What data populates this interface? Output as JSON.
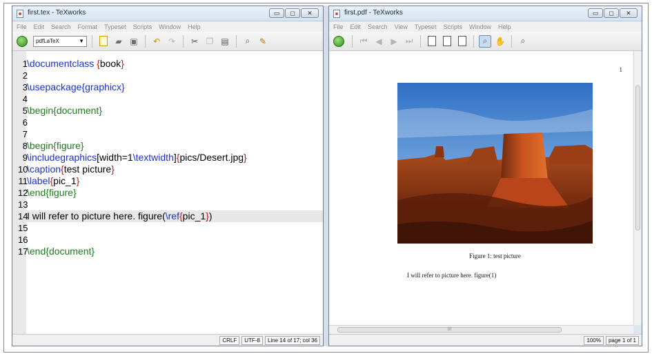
{
  "editor_window": {
    "title": "first.tex - TeXworks",
    "menu": [
      "File",
      "Edit",
      "Search",
      "Format",
      "Typeset",
      "Scripts",
      "Window",
      "Help"
    ],
    "engine": "pdfLaTeX",
    "lines": [
      {
        "n": "1",
        "tokens": [
          {
            "t": "\\documentclass",
            "c": "cmd"
          },
          {
            "t": " {",
            "c": "brace-c"
          },
          {
            "t": "book",
            "c": "plain"
          },
          {
            "t": "}",
            "c": "brace-c"
          }
        ]
      },
      {
        "n": "2",
        "tokens": []
      },
      {
        "n": "3",
        "tokens": [
          {
            "t": "\\usepackage",
            "c": "cmd"
          },
          {
            "t": "{",
            "c": "cmd"
          },
          {
            "t": "graphicx",
            "c": "cmd"
          },
          {
            "t": "}",
            "c": "cmd"
          }
        ]
      },
      {
        "n": "4",
        "tokens": []
      },
      {
        "n": "5",
        "tokens": [
          {
            "t": "\\begin",
            "c": "env"
          },
          {
            "t": "{",
            "c": "env"
          },
          {
            "t": "document",
            "c": "env"
          },
          {
            "t": "}",
            "c": "env"
          }
        ]
      },
      {
        "n": "6",
        "tokens": []
      },
      {
        "n": "7",
        "tokens": []
      },
      {
        "n": "8",
        "tokens": [
          {
            "t": "\\begin",
            "c": "env"
          },
          {
            "t": "{",
            "c": "env"
          },
          {
            "t": "figure",
            "c": "env"
          },
          {
            "t": "}",
            "c": "env"
          }
        ]
      },
      {
        "n": "9",
        "tokens": [
          {
            "t": "\\includegraphics",
            "c": "cmd"
          },
          {
            "t": "[width=1",
            "c": "plain"
          },
          {
            "t": "\\textwidth",
            "c": "cmd"
          },
          {
            "t": "]",
            "c": "plain"
          },
          {
            "t": "{",
            "c": "brace-c"
          },
          {
            "t": "pics/Desert.jpg",
            "c": "plain"
          },
          {
            "t": "}",
            "c": "brace-c"
          }
        ]
      },
      {
        "n": "10",
        "tokens": [
          {
            "t": "\\caption",
            "c": "cmd"
          },
          {
            "t": "{",
            "c": "brace-c"
          },
          {
            "t": "test picture",
            "c": "plain"
          },
          {
            "t": "}",
            "c": "brace-c"
          }
        ]
      },
      {
        "n": "11",
        "tokens": [
          {
            "t": "\\label",
            "c": "cmd"
          },
          {
            "t": "{",
            "c": "brace-c"
          },
          {
            "t": "pic_1",
            "c": "plain"
          },
          {
            "t": "}",
            "c": "brace-c"
          }
        ]
      },
      {
        "n": "12",
        "tokens": [
          {
            "t": "\\end",
            "c": "env"
          },
          {
            "t": "{",
            "c": "env"
          },
          {
            "t": "figure",
            "c": "env"
          },
          {
            "t": "}",
            "c": "env"
          }
        ]
      },
      {
        "n": "13",
        "tokens": []
      },
      {
        "n": "14",
        "tokens": [
          {
            "t": "I will refer to picture here. figure(",
            "c": "plain"
          },
          {
            "t": "\\ref",
            "c": "cmd"
          },
          {
            "t": "{",
            "c": "brace-c"
          },
          {
            "t": "pic_1",
            "c": "plain"
          },
          {
            "t": "}",
            "c": "brace-c"
          },
          {
            "t": ")",
            "c": "plain"
          }
        ],
        "current": true
      },
      {
        "n": "15",
        "tokens": []
      },
      {
        "n": "16",
        "tokens": []
      },
      {
        "n": "17",
        "tokens": [
          {
            "t": "\\end",
            "c": "env"
          },
          {
            "t": "{",
            "c": "env"
          },
          {
            "t": "document",
            "c": "env"
          },
          {
            "t": "}",
            "c": "env"
          }
        ]
      }
    ],
    "status": {
      "line_ending": "CRLF",
      "encoding": "UTF-8",
      "position": "Line 14 of 17; col 36"
    }
  },
  "pdf_window": {
    "title": "first.pdf - TeXworks",
    "menu": [
      "File",
      "Edit",
      "Search",
      "View",
      "Typeset",
      "Scripts",
      "Window",
      "Help"
    ],
    "page_number": "1",
    "caption": "Figure 1: test picture",
    "body_text": "I will refer to picture here. figure(1)",
    "zoom": "100%",
    "page_indicator": "page 1 of 1",
    "scroll_grip": "III"
  },
  "window_buttons": {
    "minimize": "▭",
    "maximize": "◻",
    "close": "✕"
  },
  "colors": {
    "command": "#1a32c8",
    "environment": "#1f7a1f",
    "brace": "#b22020",
    "typeset_green": "#2f8f1c"
  }
}
